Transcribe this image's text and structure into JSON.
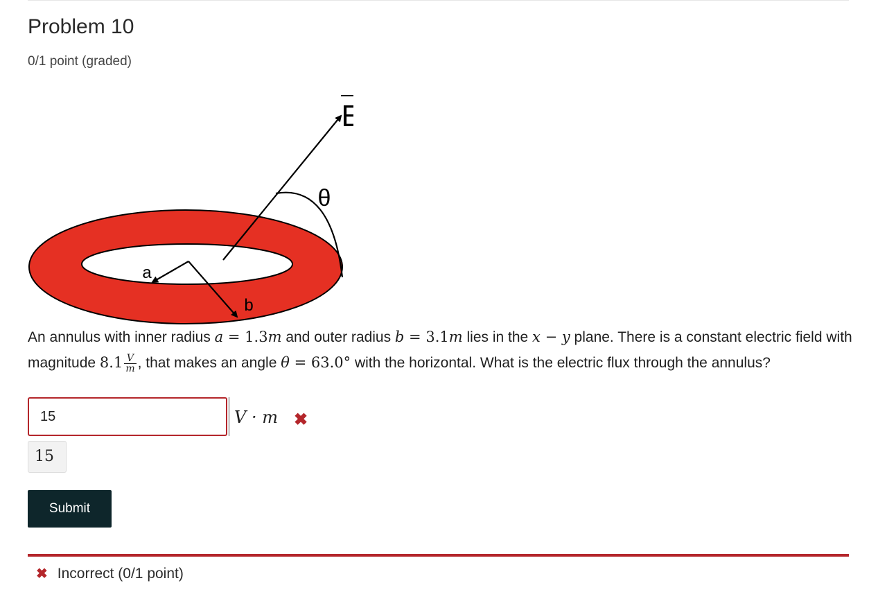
{
  "problem": {
    "title": "Problem 10",
    "points": "0/1 point (graded)"
  },
  "figure": {
    "label_field": "E",
    "label_angle": "θ",
    "label_inner": "a",
    "label_outer": "b",
    "ring_color": "#e53023"
  },
  "question": {
    "t1": "An annulus with inner radius ",
    "m_a": "a",
    "m_eq1": " = ",
    "v_a": "1.3",
    "u_a": "m",
    "t2": " and outer radius ",
    "m_b": "b",
    "m_eq2": " = ",
    "v_b": "3.1",
    "u_b": "m",
    "t3": " lies in the ",
    "m_x": "x",
    "m_minus": " − ",
    "m_y": "y",
    "t4": " plane. There is a constant electric field with magnitude ",
    "v_e": "8.1",
    "frac_num": "V",
    "frac_den": "m",
    "t5": ", that makes an angle ",
    "m_theta": "θ",
    "m_eq3": " = ",
    "v_theta": "63.0°",
    "t6": " with the horizontal. What is the electric flux through the annulus?"
  },
  "answer": {
    "value": "15",
    "unit": "V · m",
    "preview": "15",
    "incorrect_mark": "✖"
  },
  "submit_label": "Submit",
  "status": {
    "mark": "✖",
    "text": "Incorrect (0/1 point)"
  },
  "colors": {
    "error": "#b4262b",
    "button_bg": "#0e262b"
  }
}
